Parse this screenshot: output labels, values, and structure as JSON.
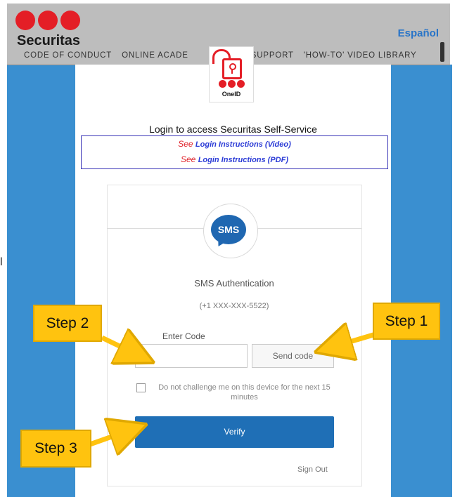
{
  "header": {
    "brand": "Securitas",
    "language_link": "Español",
    "nav": [
      "CODE OF CONDUCT",
      "ONLINE ACADE",
      "D SUPPORT",
      "'HOW-TO' VIDEO LIBRARY"
    ]
  },
  "oneid": {
    "label": "OneID"
  },
  "login": {
    "title": "Login to access Securitas Self-Service",
    "see": "See",
    "link_video": "Login Instructions (Video)",
    "link_pdf": "Login Instructions (PDF)"
  },
  "sms": {
    "icon_text": "SMS",
    "title": "SMS Authentication",
    "phone": "(+1 XXX-XXX-5522)",
    "enter_code_label": "Enter Code",
    "code_value": "",
    "send_code": "Send code",
    "remember_text": "Do not challenge me on this device for the next 15 minutes",
    "verify": "Verify",
    "sign_out": "Sign Out"
  },
  "side_fragment": "l",
  "steps": {
    "step1": "Step 1",
    "step2": "Step 2",
    "step3": "Step 3"
  },
  "colors": {
    "brand_red": "#e41e26",
    "primary_blue": "#1f6fb6",
    "callout_yellow": "#ffc30f",
    "background_blue": "#3a8fd0"
  }
}
